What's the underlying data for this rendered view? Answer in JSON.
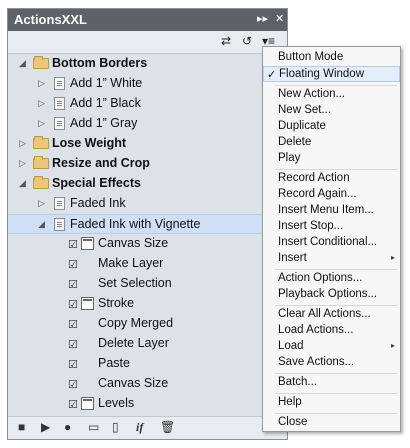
{
  "panel": {
    "title": "ActionsXXL",
    "titlebar_icons": [
      "collapse-icon",
      "close-icon"
    ],
    "toolbar_icons": [
      "toggle-dialog-icon",
      "reset-icon",
      "panel-menu-icon"
    ]
  },
  "rows": {
    "r0": "Bottom Borders",
    "r1": "Add 1” White",
    "r2": "Add 1” Black",
    "r3": "Add 1” Gray",
    "r4": "Lose Weight",
    "r5": "Resize and Crop",
    "r6": "Special Effects",
    "r7": "Faded Ink",
    "r8": "Faded Ink with Vignette",
    "r9": "Canvas Size",
    "r10": "Make Layer",
    "r11": "Set Selection",
    "r12": "Stroke",
    "r13": "Copy Merged",
    "r14": "Delete Layer",
    "r15": "Paste",
    "r16": "Canvas Size",
    "r17": "Levels"
  },
  "bottom_icons": [
    "stop-icon",
    "play-icon",
    "record-icon",
    "new-set-icon",
    "new-action-icon",
    "conditional-icon",
    "trash-icon"
  ],
  "bottom_glyphs": {
    "conditional": "if"
  },
  "menu": {
    "m0": "Button Mode",
    "m1": "Floating Window",
    "m1_check": "✓",
    "m2": "New Action...",
    "m3": "New Set...",
    "m4": "Duplicate",
    "m5": "Delete",
    "m6": "Play",
    "m7": "Record Action",
    "m8": "Record Again...",
    "m9": "Insert Menu Item...",
    "m10": "Insert Stop...",
    "m11": "Insert Conditional...",
    "m12": "Insert",
    "m13": "Action Options...",
    "m14": "Playback Options...",
    "m15": "Clear All Actions...",
    "m16": "Load Actions...",
    "m17": "Load",
    "m18": "Save Actions...",
    "m19": "Batch...",
    "m20": "Help",
    "m21": "Close"
  },
  "colors": {
    "titlebar": "#5e6167",
    "panel_bg": "#dde1e8",
    "selected_row": "#cfe0f6",
    "folder": "#e9c979"
  }
}
